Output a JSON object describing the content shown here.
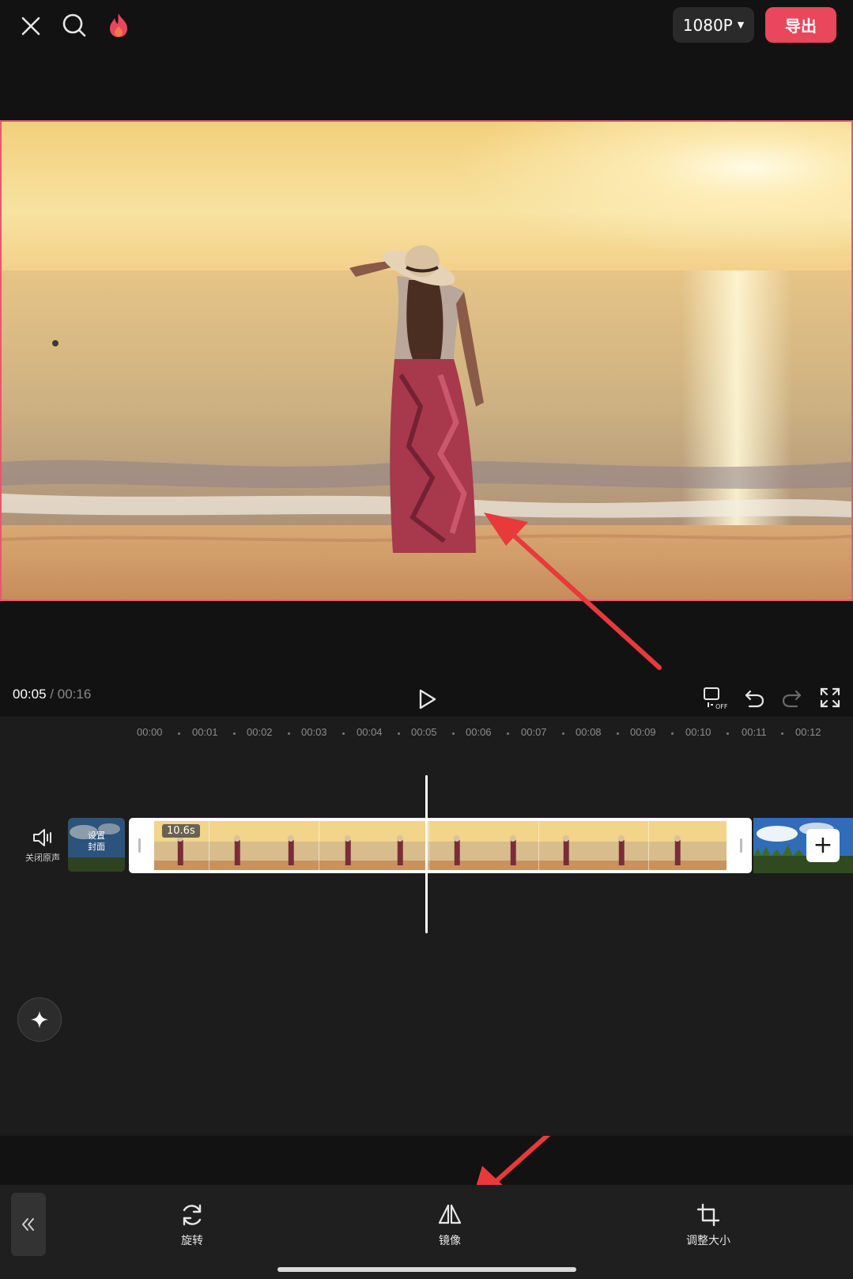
{
  "header": {
    "close_icon": "close-icon",
    "search_icon": "search-icon",
    "fire_icon": "fire-icon",
    "resolution": "1080P",
    "export_label": "导出",
    "accent": "#e8475c"
  },
  "playback": {
    "current_time": "00:05",
    "separator": "/",
    "total_time": "00:16"
  },
  "timeline": {
    "ruler": [
      "00:00",
      "00:01",
      "00:02",
      "00:03",
      "00:04",
      "00:05",
      "00:06",
      "00:07",
      "00:08",
      "00:09",
      "00:10",
      "00:11",
      "00:12"
    ],
    "mute_label": "关闭原声",
    "cover_label_line1": "设置",
    "cover_label_line2": "封面",
    "clip_duration": "10.6s",
    "add_icon": "+"
  },
  "toolbar": {
    "rotate_label": "旋转",
    "mirror_label": "镜像",
    "resize_label": "调整大小"
  }
}
